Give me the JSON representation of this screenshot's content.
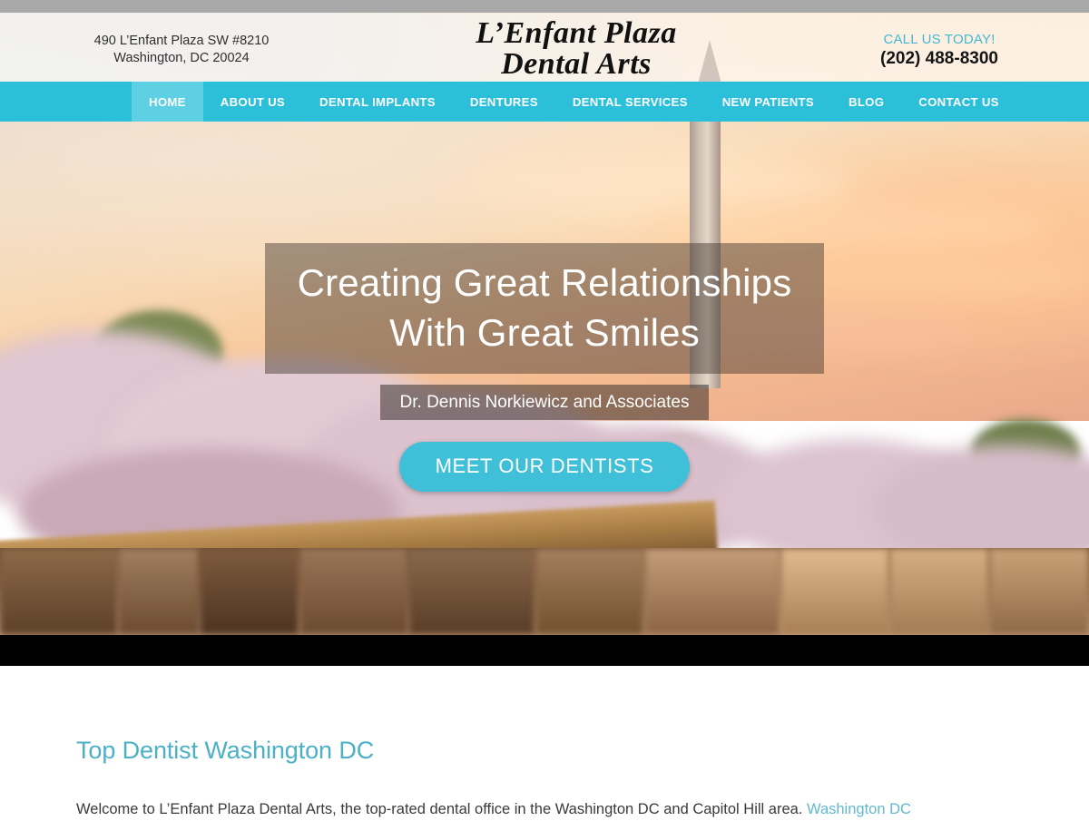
{
  "header": {
    "address_line1": "490 L’Enfant Plaza SW #8210",
    "address_line2": "Washington, DC 20024",
    "logo_line1": "L’Enfant Plaza",
    "logo_line2": "Dental Arts",
    "call_label": "CALL US TODAY!",
    "phone": "(202) 488-8300"
  },
  "nav": {
    "items": [
      {
        "label": "HOME",
        "active": true
      },
      {
        "label": "ABOUT US",
        "active": false
      },
      {
        "label": "DENTAL IMPLANTS",
        "active": false
      },
      {
        "label": "DENTURES",
        "active": false
      },
      {
        "label": "DENTAL SERVICES",
        "active": false
      },
      {
        "label": "NEW PATIENTS",
        "active": false
      },
      {
        "label": "BLOG",
        "active": false
      },
      {
        "label": "CONTACT US",
        "active": false
      }
    ]
  },
  "hero": {
    "headline_line1": "Creating Great Relationships",
    "headline_line2": "With Great Smiles",
    "subline": "Dr. Dennis Norkiewicz and Associates",
    "cta_label": "MEET OUR DENTISTS"
  },
  "main": {
    "heading": "Top Dentist Washington DC",
    "paragraph_before": "Welcome to L’Enfant Plaza Dental Arts, the top-rated dental office in the Washington DC and Capitol Hill area. ",
    "paragraph_link": "Washington DC"
  },
  "colors": {
    "teal": "#2BBFDA",
    "teal_active": "#5ED0E4",
    "heading_teal": "#4CB0C6",
    "link_teal": "#62B9CE",
    "top_strip_gray": "#A9A9A9",
    "divider_black": "#000000",
    "cta_teal": "#3FC0D8"
  }
}
